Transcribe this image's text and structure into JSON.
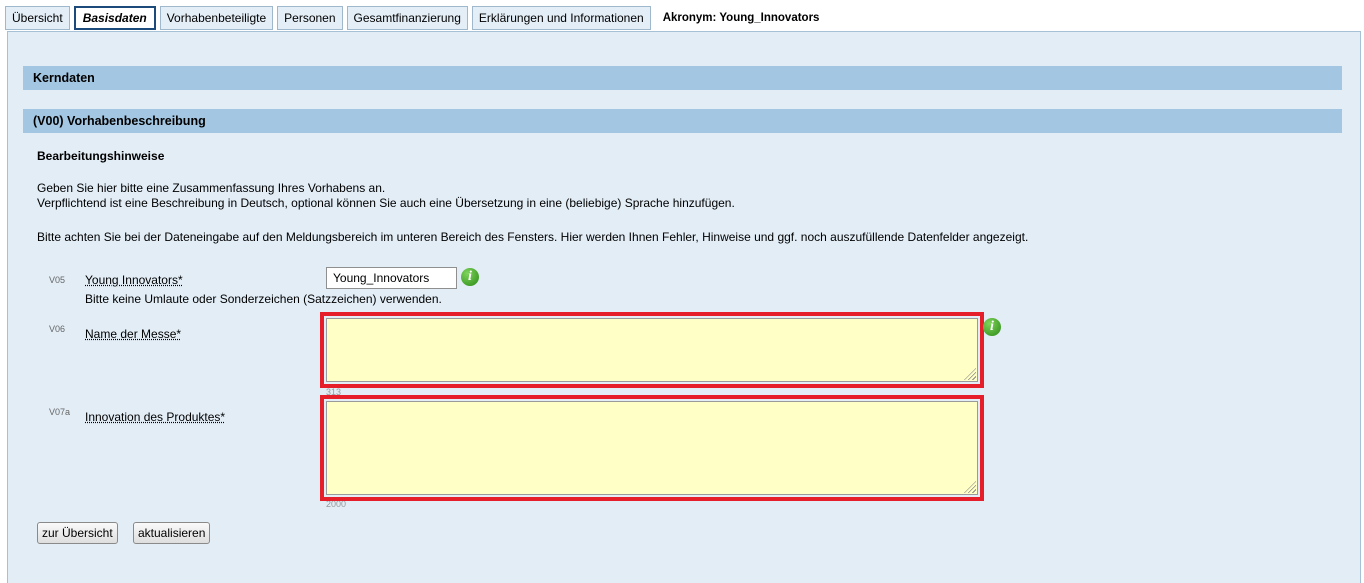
{
  "tabs": [
    {
      "label": "Übersicht"
    },
    {
      "label": "Basisdaten"
    },
    {
      "label": "Vorhabenbeteiligte"
    },
    {
      "label": "Personen"
    },
    {
      "label": "Gesamtfinanzierung"
    },
    {
      "label": "Erklärungen und Informationen"
    }
  ],
  "acronym": "Akronym: Young_Innovators",
  "sections": {
    "kerndaten": "Kerndaten",
    "vorhaben": "(V00) Vorhabenbeschreibung"
  },
  "hints": {
    "title": "Bearbeitungshinweise",
    "line1": "Geben Sie hier bitte eine Zusammenfassung Ihres Vorhabens an.",
    "line2": "Verpflichtend ist eine Beschreibung in Deutsch, optional können Sie auch eine Übersetzung in eine (beliebige) Sprache hinzufügen.",
    "line3": "Bitte achten Sie bei der Dateneingabe auf den Meldungsbereich im unteren Bereich des Fensters. Hier werden Ihnen Fehler, Hinweise und ggf. noch auszufüllende Datenfelder angezeigt."
  },
  "fields": {
    "v05": {
      "code": "V05",
      "label": "Young Innovators*",
      "value": "Young_Innovators",
      "note": "Bitte keine Umlaute oder Sonderzeichen (Satzzeichen) verwenden."
    },
    "v06": {
      "code": "V06",
      "label": "Name der Messe*",
      "counter": "313"
    },
    "v07a": {
      "code": "V07a",
      "label": "Innovation des Produktes*",
      "counter": "2000"
    }
  },
  "buttons": {
    "overview": "zur Übersicht",
    "refresh": "aktualisieren"
  },
  "icons": {
    "info": "info-icon",
    "resize": "resize-grip-icon"
  },
  "colors": {
    "highlight": "#e51e2a",
    "section_bar": "#a3c7e2",
    "panel": "#e2edf6",
    "textarea": "#ffffc6"
  }
}
